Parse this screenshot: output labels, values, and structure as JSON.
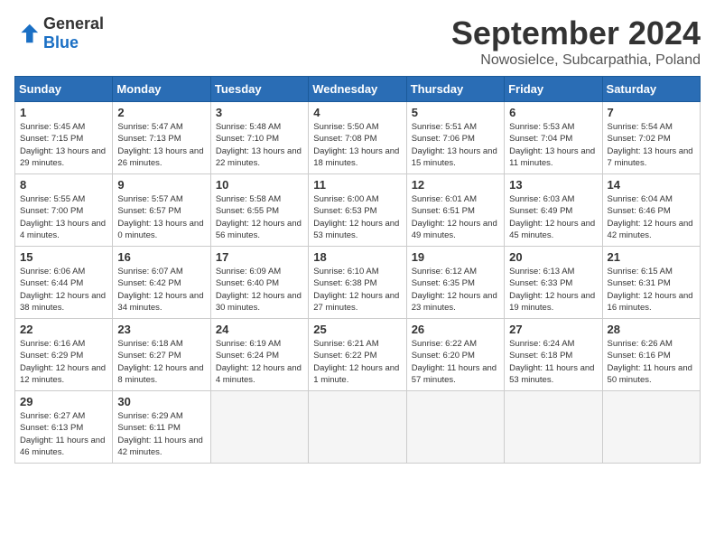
{
  "logo": {
    "general": "General",
    "blue": "Blue"
  },
  "title": "September 2024",
  "location": "Nowosielce, Subcarpathia, Poland",
  "headers": [
    "Sunday",
    "Monday",
    "Tuesday",
    "Wednesday",
    "Thursday",
    "Friday",
    "Saturday"
  ],
  "weeks": [
    [
      {
        "day": "1",
        "sunrise": "5:45 AM",
        "sunset": "7:15 PM",
        "daylight": "13 hours and 29 minutes."
      },
      {
        "day": "2",
        "sunrise": "5:47 AM",
        "sunset": "7:13 PM",
        "daylight": "13 hours and 26 minutes."
      },
      {
        "day": "3",
        "sunrise": "5:48 AM",
        "sunset": "7:10 PM",
        "daylight": "13 hours and 22 minutes."
      },
      {
        "day": "4",
        "sunrise": "5:50 AM",
        "sunset": "7:08 PM",
        "daylight": "13 hours and 18 minutes."
      },
      {
        "day": "5",
        "sunrise": "5:51 AM",
        "sunset": "7:06 PM",
        "daylight": "13 hours and 15 minutes."
      },
      {
        "day": "6",
        "sunrise": "5:53 AM",
        "sunset": "7:04 PM",
        "daylight": "13 hours and 11 minutes."
      },
      {
        "day": "7",
        "sunrise": "5:54 AM",
        "sunset": "7:02 PM",
        "daylight": "13 hours and 7 minutes."
      }
    ],
    [
      {
        "day": "8",
        "sunrise": "5:55 AM",
        "sunset": "7:00 PM",
        "daylight": "13 hours and 4 minutes."
      },
      {
        "day": "9",
        "sunrise": "5:57 AM",
        "sunset": "6:57 PM",
        "daylight": "13 hours and 0 minutes."
      },
      {
        "day": "10",
        "sunrise": "5:58 AM",
        "sunset": "6:55 PM",
        "daylight": "12 hours and 56 minutes."
      },
      {
        "day": "11",
        "sunrise": "6:00 AM",
        "sunset": "6:53 PM",
        "daylight": "12 hours and 53 minutes."
      },
      {
        "day": "12",
        "sunrise": "6:01 AM",
        "sunset": "6:51 PM",
        "daylight": "12 hours and 49 minutes."
      },
      {
        "day": "13",
        "sunrise": "6:03 AM",
        "sunset": "6:49 PM",
        "daylight": "12 hours and 45 minutes."
      },
      {
        "day": "14",
        "sunrise": "6:04 AM",
        "sunset": "6:46 PM",
        "daylight": "12 hours and 42 minutes."
      }
    ],
    [
      {
        "day": "15",
        "sunrise": "6:06 AM",
        "sunset": "6:44 PM",
        "daylight": "12 hours and 38 minutes."
      },
      {
        "day": "16",
        "sunrise": "6:07 AM",
        "sunset": "6:42 PM",
        "daylight": "12 hours and 34 minutes."
      },
      {
        "day": "17",
        "sunrise": "6:09 AM",
        "sunset": "6:40 PM",
        "daylight": "12 hours and 30 minutes."
      },
      {
        "day": "18",
        "sunrise": "6:10 AM",
        "sunset": "6:38 PM",
        "daylight": "12 hours and 27 minutes."
      },
      {
        "day": "19",
        "sunrise": "6:12 AM",
        "sunset": "6:35 PM",
        "daylight": "12 hours and 23 minutes."
      },
      {
        "day": "20",
        "sunrise": "6:13 AM",
        "sunset": "6:33 PM",
        "daylight": "12 hours and 19 minutes."
      },
      {
        "day": "21",
        "sunrise": "6:15 AM",
        "sunset": "6:31 PM",
        "daylight": "12 hours and 16 minutes."
      }
    ],
    [
      {
        "day": "22",
        "sunrise": "6:16 AM",
        "sunset": "6:29 PM",
        "daylight": "12 hours and 12 minutes."
      },
      {
        "day": "23",
        "sunrise": "6:18 AM",
        "sunset": "6:27 PM",
        "daylight": "12 hours and 8 minutes."
      },
      {
        "day": "24",
        "sunrise": "6:19 AM",
        "sunset": "6:24 PM",
        "daylight": "12 hours and 4 minutes."
      },
      {
        "day": "25",
        "sunrise": "6:21 AM",
        "sunset": "6:22 PM",
        "daylight": "12 hours and 1 minute."
      },
      {
        "day": "26",
        "sunrise": "6:22 AM",
        "sunset": "6:20 PM",
        "daylight": "11 hours and 57 minutes."
      },
      {
        "day": "27",
        "sunrise": "6:24 AM",
        "sunset": "6:18 PM",
        "daylight": "11 hours and 53 minutes."
      },
      {
        "day": "28",
        "sunrise": "6:26 AM",
        "sunset": "6:16 PM",
        "daylight": "11 hours and 50 minutes."
      }
    ],
    [
      {
        "day": "29",
        "sunrise": "6:27 AM",
        "sunset": "6:13 PM",
        "daylight": "11 hours and 46 minutes."
      },
      {
        "day": "30",
        "sunrise": "6:29 AM",
        "sunset": "6:11 PM",
        "daylight": "11 hours and 42 minutes."
      },
      null,
      null,
      null,
      null,
      null
    ]
  ]
}
